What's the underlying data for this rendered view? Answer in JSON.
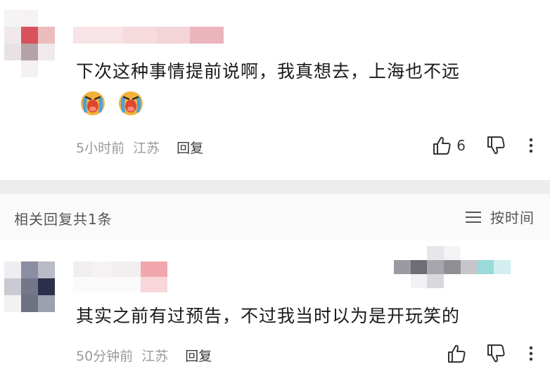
{
  "main_comment": {
    "text": "下次这种事情提前说啊，我真想去，上海也不远",
    "emojis": [
      "crying-emoji",
      "crying-emoji"
    ],
    "time": "5小时前",
    "location": "江苏",
    "reply_label": "回复",
    "like_count": "6"
  },
  "replies_header": {
    "count_label": "相关回复共1条",
    "sort_label": "按时间"
  },
  "reply_comment": {
    "text": "其实之前有过预告，不过我当时以为是开玩笑的",
    "time": "50分钟前",
    "location": "江苏",
    "reply_label": "回复"
  },
  "colors": {
    "divider": "#ededed",
    "meta_text": "#9a9a9a",
    "emoji_face": "#f2b23a",
    "emoji_tears": "#4aa3df",
    "emoji_mouth": "#e0452f"
  }
}
